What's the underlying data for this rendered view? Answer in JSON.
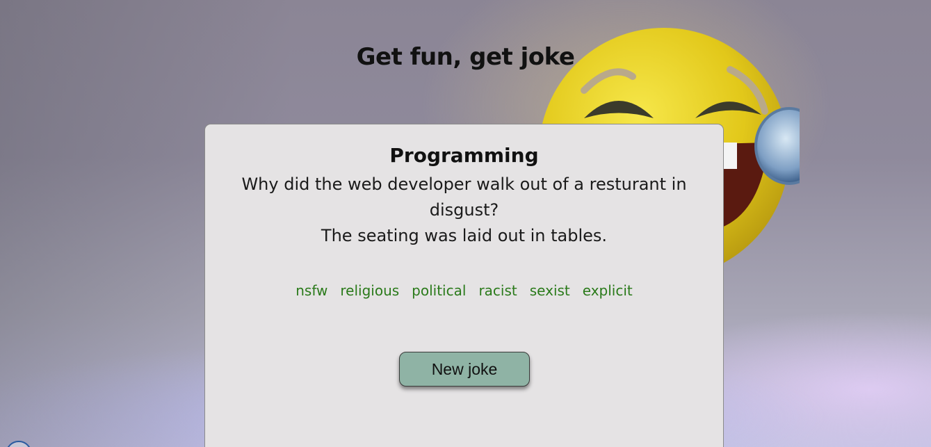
{
  "page": {
    "title": "Get fun, get joke"
  },
  "joke": {
    "category": "Programming",
    "setup": "Why did the web developer walk out of a resturant in disgust?",
    "delivery": "The seating was laid out in tables.",
    "flags": [
      "nsfw",
      "religious",
      "political",
      "racist",
      "sexist",
      "explicit"
    ]
  },
  "actions": {
    "new_joke_label": "New joke"
  },
  "colors": {
    "card_background": "#e5e3e4",
    "flag_text": "#2a7a1a",
    "button_background": "#8fb3a5"
  },
  "background": {
    "image_subject": "laughing-emoji-with-glasses-icon"
  }
}
